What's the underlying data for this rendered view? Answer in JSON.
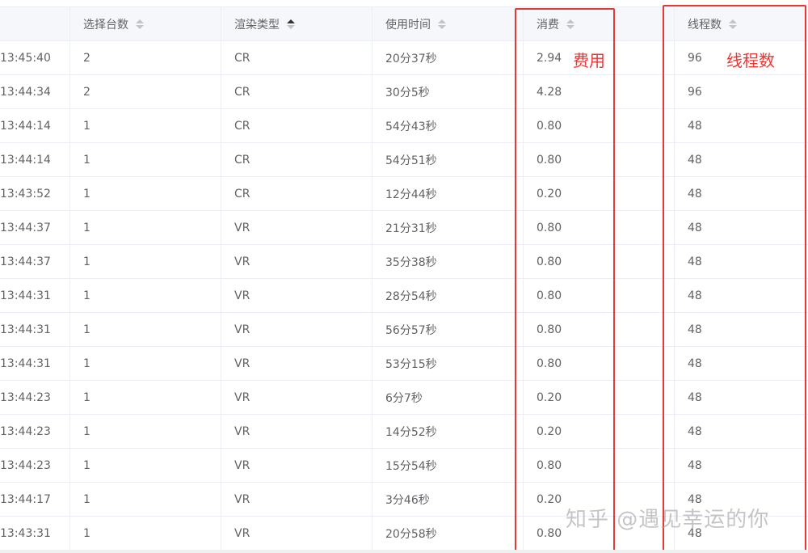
{
  "headers": {
    "count": "选择台数",
    "render_type": "渲染类型",
    "duration": "使用时间",
    "cost": "消费",
    "threads": "线程数"
  },
  "rows": [
    {
      "time": "13:45:40",
      "count": "2",
      "type": "CR",
      "duration": "20分37秒",
      "cost": "2.94",
      "threads": "96"
    },
    {
      "time": "13:44:34",
      "count": "2",
      "type": "CR",
      "duration": "30分5秒",
      "cost": "4.28",
      "threads": "96"
    },
    {
      "time": "13:44:14",
      "count": "1",
      "type": "CR",
      "duration": "54分43秒",
      "cost": "0.80",
      "threads": "48"
    },
    {
      "time": "13:44:14",
      "count": "1",
      "type": "CR",
      "duration": "54分51秒",
      "cost": "0.80",
      "threads": "48"
    },
    {
      "time": "13:43:52",
      "count": "1",
      "type": "CR",
      "duration": "12分44秒",
      "cost": "0.20",
      "threads": "48"
    },
    {
      "time": "13:44:37",
      "count": "1",
      "type": "VR",
      "duration": "21分31秒",
      "cost": "0.80",
      "threads": "48"
    },
    {
      "time": "13:44:37",
      "count": "1",
      "type": "VR",
      "duration": "35分38秒",
      "cost": "0.80",
      "threads": "48"
    },
    {
      "time": "13:44:31",
      "count": "1",
      "type": "VR",
      "duration": "28分54秒",
      "cost": "0.80",
      "threads": "48"
    },
    {
      "time": "13:44:31",
      "count": "1",
      "type": "VR",
      "duration": "56分57秒",
      "cost": "0.80",
      "threads": "48"
    },
    {
      "time": "13:44:31",
      "count": "1",
      "type": "VR",
      "duration": "53分15秒",
      "cost": "0.80",
      "threads": "48"
    },
    {
      "time": "13:44:23",
      "count": "1",
      "type": "VR",
      "duration": "6分7秒",
      "cost": "0.20",
      "threads": "48"
    },
    {
      "time": "13:44:23",
      "count": "1",
      "type": "VR",
      "duration": "14分52秒",
      "cost": "0.20",
      "threads": "48"
    },
    {
      "time": "13:44:23",
      "count": "1",
      "type": "VR",
      "duration": "15分54秒",
      "cost": "0.80",
      "threads": "48"
    },
    {
      "time": "13:44:17",
      "count": "1",
      "type": "VR",
      "duration": "3分46秒",
      "cost": "0.20",
      "threads": "48"
    },
    {
      "time": "13:43:31",
      "count": "1",
      "type": "VR",
      "duration": "20分58秒",
      "cost": "0.80",
      "threads": "48"
    }
  ],
  "annotations": {
    "cost_note": "费用",
    "threads_note": "线程数"
  },
  "watermark": "知乎 @遇见幸运的你",
  "sort": {
    "active_column": "render_type",
    "direction": "ascending"
  },
  "colors": {
    "highlight_red": "#e53935",
    "header_bg": "#f5f7fa",
    "border": "#ebeef5",
    "text": "#606266"
  }
}
